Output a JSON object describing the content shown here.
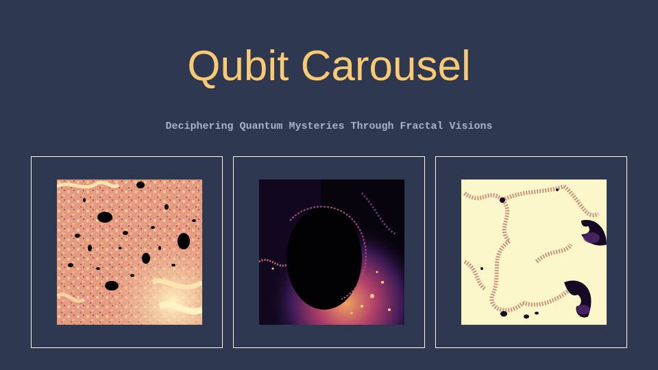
{
  "slide": {
    "title": "Qubit Carousel",
    "subtitle": "Deciphering Quantum Mysteries Through Fractal Visions"
  },
  "carousel": {
    "items": [
      {
        "image": "fractal-pink-image",
        "palette": [
          "#e8a085",
          "#f7d8a0",
          "#000000"
        ]
      },
      {
        "image": "fractal-dark-image",
        "palette": [
          "#0a0410",
          "#3a1a55",
          "#f0a060"
        ]
      },
      {
        "image": "fractal-cream-image",
        "palette": [
          "#fbf7c8",
          "#d9a090",
          "#1a1030"
        ]
      }
    ]
  },
  "colors": {
    "background": "#2e3850",
    "title": "#fbca72",
    "subtitle": "#a8b2c6",
    "frame_border": "#ffffff"
  }
}
